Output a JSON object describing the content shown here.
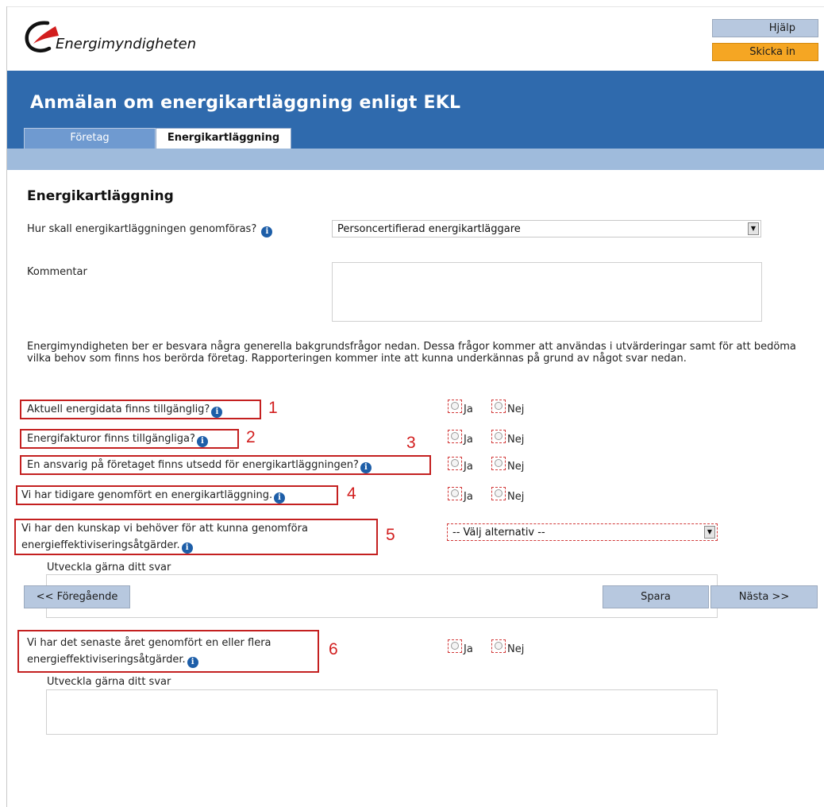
{
  "header": {
    "logo_text": "Energimyndigheten",
    "help_label": "Hjälp",
    "submit_label": "Skicka in"
  },
  "banner": {
    "title": "Anmälan om energikartläggning enligt EKL",
    "tabs": [
      "Företag",
      "Energikartläggning"
    ]
  },
  "section": {
    "title": "Energikartläggning",
    "method_label": "Hur skall energikartläggningen genomföras?",
    "method_value": "Personcertifierad energikartläggare",
    "comment_label": "Kommentar",
    "intro": "Energimyndigheten ber er besvara några generella bakgrundsfrågor nedan. Dessa frågor kommer att användas i utvärderingar samt för att bedöma vilka behov som finns hos berörda företag. Rapporteringen kommer inte att kunna underkännas på grund av något svar nedan."
  },
  "questions": [
    {
      "text": "Aktuell energidata finns tillgänglig?",
      "number": "1"
    },
    {
      "text": "Energifakturor finns tillgängliga?",
      "number": "2"
    },
    {
      "text": "En ansvarig på företaget finns utsedd för energikartläggningen?",
      "number": "3"
    },
    {
      "text": "Vi har tidigare genomfört en energikartläggning.",
      "number": "4"
    },
    {
      "text_line1": "Vi har den kunskap vi behöver för att kunna genomföra",
      "text_line2": "energieffektiviseringsåtgärder.",
      "number": "5",
      "select_value": "-- Välj alternativ --"
    },
    {
      "text_line1": "Vi har det senaste året genomfört en eller flera",
      "text_line2": "energieffektiviseringsåtgärder.",
      "number": "6"
    }
  ],
  "options": {
    "yes": "Ja",
    "no": "Nej"
  },
  "elaborate_label": "Utveckla gärna ditt svar",
  "nav": {
    "prev_label": "<< Föregående",
    "save_label": "Spara",
    "next_label": "Nästa >>"
  },
  "colors": {
    "banner": "#2f6aad",
    "subbar": "#9fbbdc",
    "button": "#b7c8df",
    "submit": "#f5a623",
    "highlight": "#c42020",
    "info_icon": "#1d5ea8"
  }
}
